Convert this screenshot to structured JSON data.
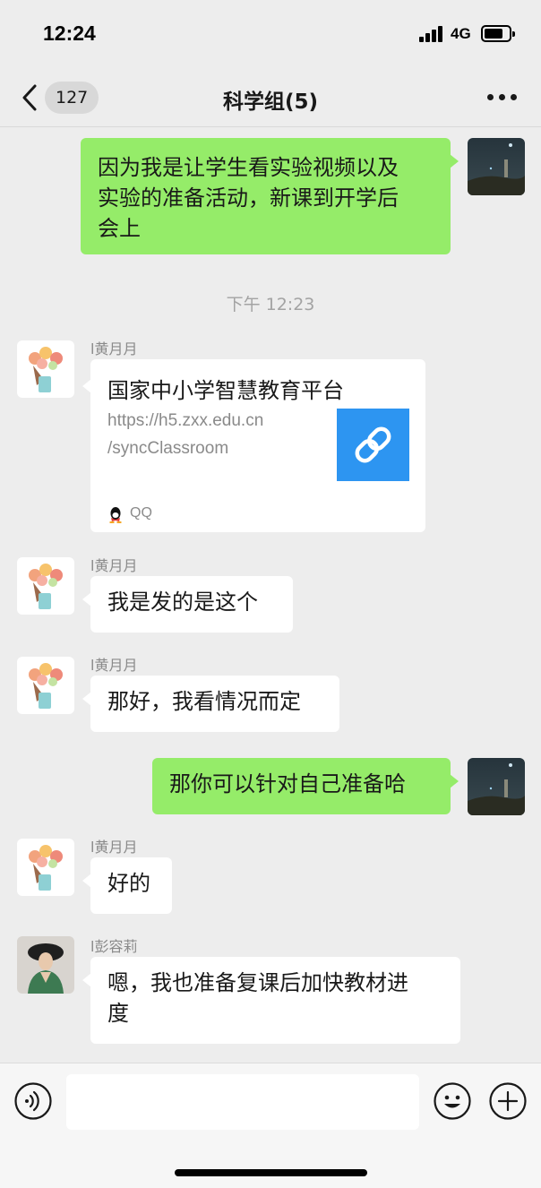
{
  "status_bar": {
    "time": "12:24",
    "network": "4G"
  },
  "nav": {
    "back_icon": "chevron-left-icon",
    "unread_count": "127",
    "title": "科学组(5)",
    "more_icon": "ellipsis-icon"
  },
  "messages": [
    {
      "direction": "outgoing",
      "type": "text",
      "text_lines": [
        "因为我是让学生看实验视频以及",
        "实验的准备活动，新课到开学后",
        "会上"
      ]
    },
    {
      "type": "timestamp",
      "text": "下午 12:23"
    },
    {
      "direction": "incoming",
      "type": "link",
      "sender": "l黄月月",
      "link": {
        "title": "国家中小学智慧教育平台",
        "url_lines": [
          "https://h5.zxx.edu.cn",
          "/syncClassroom"
        ],
        "thumb_icon": "link-icon",
        "source_icon": "qq-icon",
        "source": "QQ"
      }
    },
    {
      "direction": "incoming",
      "type": "text",
      "sender": "l黄月月",
      "text": "我是发的是这个"
    },
    {
      "direction": "incoming",
      "type": "text",
      "sender": "l黄月月",
      "text": "那好，我看情况而定"
    },
    {
      "direction": "outgoing",
      "type": "text",
      "text": "那你可以针对自己准备哈"
    },
    {
      "direction": "incoming",
      "type": "text",
      "sender": "l黄月月",
      "text": "好的"
    },
    {
      "direction": "incoming",
      "type": "text",
      "sender": "l彭容莉",
      "text_lines": [
        "嗯，我也准备复课后加快教材进",
        "度"
      ]
    }
  ],
  "input_bar": {
    "voice_icon": "voice-icon",
    "emoji_icon": "emoji-icon",
    "plus_icon": "plus-icon",
    "input_value": ""
  },
  "colors": {
    "background": "#ededed",
    "outgoing_bubble": "#95ec69",
    "incoming_bubble": "#ffffff",
    "link_thumb": "#2d95f1"
  }
}
